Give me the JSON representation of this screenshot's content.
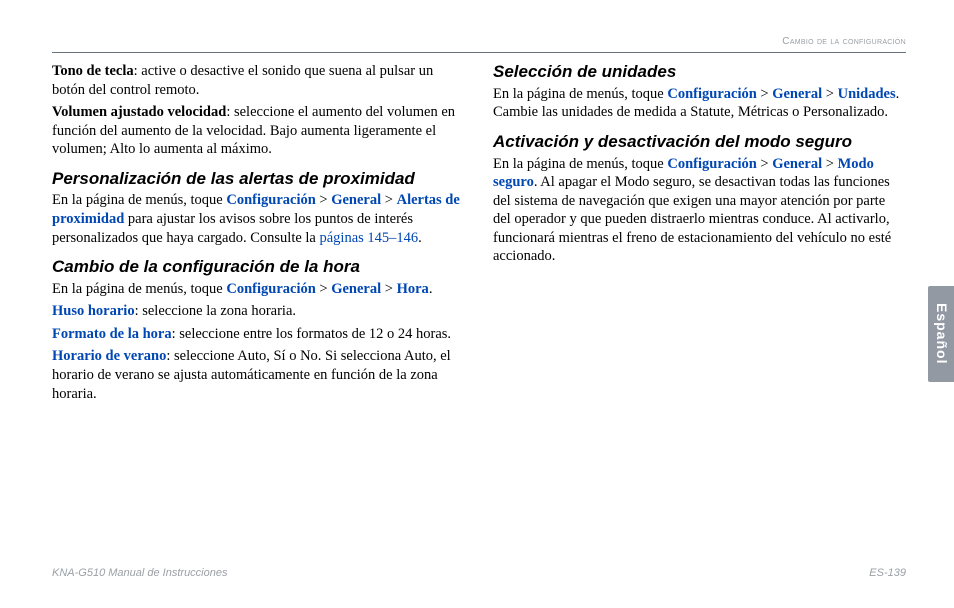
{
  "header": {
    "running_title": "Cambio de la configuración"
  },
  "left": {
    "tono_label": "Tono de tecla",
    "tono_text": ": active o desactive el sonido que suena al pulsar un botón del control remoto.",
    "vol_label": "Volumen ajustado velocidad",
    "vol_text": ": seleccione el aumento del volumen en función del aumento de la velocidad. Bajo aumenta ligeramente el volumen; Alto lo aumenta al máximo.",
    "sec1_title": "Personalización de las alertas de proximidad",
    "sec1_pre": "En la página de menús, toque ",
    "link_config": "Configuración",
    "link_general": "General",
    "link_alertas": "Alertas de proximidad",
    "sec1_post": " para ajustar los avisos sobre los puntos de interés personalizados que haya cargado. Consulte la ",
    "sec1_pages": "páginas 145–146",
    "sec2_title": "Cambio de la configuración de la hora",
    "sec2_pre": "En la página de menús, toque ",
    "link_hora": "Hora",
    "huso_label": "Huso horario",
    "huso_text": ": seleccione la zona horaria.",
    "formato_label": "Formato de la hora",
    "formato_text": ": seleccione entre los formatos de 12 o 24 horas.",
    "verano_label": "Horario de verano",
    "verano_text": ": seleccione Auto, Sí o No. Si selecciona Auto, el horario de verano se ajusta automáticamente en función de la zona horaria."
  },
  "right": {
    "sec3_title": "Selección de unidades",
    "sec3_pre": "En la página de menús, toque ",
    "link_unidades": "Unidades",
    "sec3_post": ". Cambie las unidades de medida a Statute, Métricas o Personalizado.",
    "sec4_title": "Activación y desactivación del modo seguro",
    "sec4_pre": "En la página de menús, toque ",
    "link_modo": "Modo seguro",
    "sec4_post": ". Al apagar el Modo seguro, se desactivan todas las funciones del sistema de navegación que exigen una mayor atención por parte del operador y que pueden distraerlo mientras conduce. Al activarlo, funcionará mientras el freno de estacionamiento del vehículo no esté accionado."
  },
  "side_tab": "Español",
  "footer": {
    "left": "KNA-G510 Manual de Instrucciones",
    "right": "ES-139"
  },
  "glyphs": {
    "gt": " > ",
    "period": "."
  }
}
